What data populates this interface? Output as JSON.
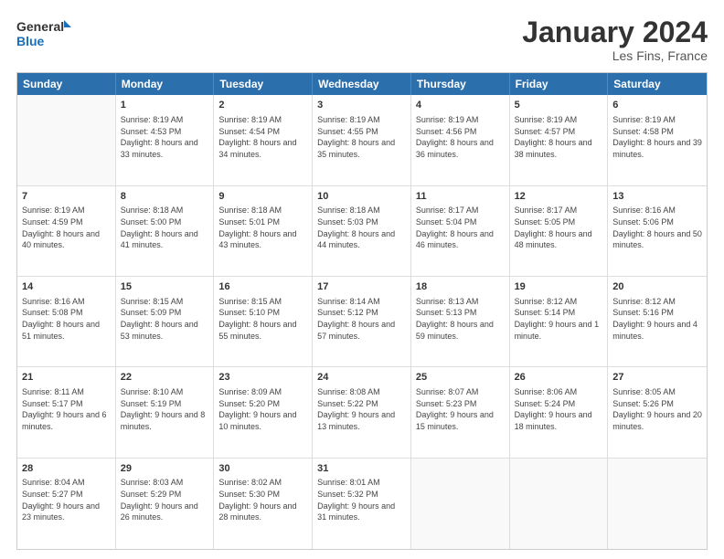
{
  "logo": {
    "line1": "General",
    "line2": "Blue"
  },
  "title": "January 2024",
  "subtitle": "Les Fins, France",
  "header_days": [
    "Sunday",
    "Monday",
    "Tuesday",
    "Wednesday",
    "Thursday",
    "Friday",
    "Saturday"
  ],
  "weeks": [
    [
      {
        "day": "",
        "sunrise": "",
        "sunset": "",
        "daylight": ""
      },
      {
        "day": "1",
        "sunrise": "Sunrise: 8:19 AM",
        "sunset": "Sunset: 4:53 PM",
        "daylight": "Daylight: 8 hours and 33 minutes."
      },
      {
        "day": "2",
        "sunrise": "Sunrise: 8:19 AM",
        "sunset": "Sunset: 4:54 PM",
        "daylight": "Daylight: 8 hours and 34 minutes."
      },
      {
        "day": "3",
        "sunrise": "Sunrise: 8:19 AM",
        "sunset": "Sunset: 4:55 PM",
        "daylight": "Daylight: 8 hours and 35 minutes."
      },
      {
        "day": "4",
        "sunrise": "Sunrise: 8:19 AM",
        "sunset": "Sunset: 4:56 PM",
        "daylight": "Daylight: 8 hours and 36 minutes."
      },
      {
        "day": "5",
        "sunrise": "Sunrise: 8:19 AM",
        "sunset": "Sunset: 4:57 PM",
        "daylight": "Daylight: 8 hours and 38 minutes."
      },
      {
        "day": "6",
        "sunrise": "Sunrise: 8:19 AM",
        "sunset": "Sunset: 4:58 PM",
        "daylight": "Daylight: 8 hours and 39 minutes."
      }
    ],
    [
      {
        "day": "7",
        "sunrise": "Sunrise: 8:19 AM",
        "sunset": "Sunset: 4:59 PM",
        "daylight": "Daylight: 8 hours and 40 minutes."
      },
      {
        "day": "8",
        "sunrise": "Sunrise: 8:18 AM",
        "sunset": "Sunset: 5:00 PM",
        "daylight": "Daylight: 8 hours and 41 minutes."
      },
      {
        "day": "9",
        "sunrise": "Sunrise: 8:18 AM",
        "sunset": "Sunset: 5:01 PM",
        "daylight": "Daylight: 8 hours and 43 minutes."
      },
      {
        "day": "10",
        "sunrise": "Sunrise: 8:18 AM",
        "sunset": "Sunset: 5:03 PM",
        "daylight": "Daylight: 8 hours and 44 minutes."
      },
      {
        "day": "11",
        "sunrise": "Sunrise: 8:17 AM",
        "sunset": "Sunset: 5:04 PM",
        "daylight": "Daylight: 8 hours and 46 minutes."
      },
      {
        "day": "12",
        "sunrise": "Sunrise: 8:17 AM",
        "sunset": "Sunset: 5:05 PM",
        "daylight": "Daylight: 8 hours and 48 minutes."
      },
      {
        "day": "13",
        "sunrise": "Sunrise: 8:16 AM",
        "sunset": "Sunset: 5:06 PM",
        "daylight": "Daylight: 8 hours and 50 minutes."
      }
    ],
    [
      {
        "day": "14",
        "sunrise": "Sunrise: 8:16 AM",
        "sunset": "Sunset: 5:08 PM",
        "daylight": "Daylight: 8 hours and 51 minutes."
      },
      {
        "day": "15",
        "sunrise": "Sunrise: 8:15 AM",
        "sunset": "Sunset: 5:09 PM",
        "daylight": "Daylight: 8 hours and 53 minutes."
      },
      {
        "day": "16",
        "sunrise": "Sunrise: 8:15 AM",
        "sunset": "Sunset: 5:10 PM",
        "daylight": "Daylight: 8 hours and 55 minutes."
      },
      {
        "day": "17",
        "sunrise": "Sunrise: 8:14 AM",
        "sunset": "Sunset: 5:12 PM",
        "daylight": "Daylight: 8 hours and 57 minutes."
      },
      {
        "day": "18",
        "sunrise": "Sunrise: 8:13 AM",
        "sunset": "Sunset: 5:13 PM",
        "daylight": "Daylight: 8 hours and 59 minutes."
      },
      {
        "day": "19",
        "sunrise": "Sunrise: 8:12 AM",
        "sunset": "Sunset: 5:14 PM",
        "daylight": "Daylight: 9 hours and 1 minute."
      },
      {
        "day": "20",
        "sunrise": "Sunrise: 8:12 AM",
        "sunset": "Sunset: 5:16 PM",
        "daylight": "Daylight: 9 hours and 4 minutes."
      }
    ],
    [
      {
        "day": "21",
        "sunrise": "Sunrise: 8:11 AM",
        "sunset": "Sunset: 5:17 PM",
        "daylight": "Daylight: 9 hours and 6 minutes."
      },
      {
        "day": "22",
        "sunrise": "Sunrise: 8:10 AM",
        "sunset": "Sunset: 5:19 PM",
        "daylight": "Daylight: 9 hours and 8 minutes."
      },
      {
        "day": "23",
        "sunrise": "Sunrise: 8:09 AM",
        "sunset": "Sunset: 5:20 PM",
        "daylight": "Daylight: 9 hours and 10 minutes."
      },
      {
        "day": "24",
        "sunrise": "Sunrise: 8:08 AM",
        "sunset": "Sunset: 5:22 PM",
        "daylight": "Daylight: 9 hours and 13 minutes."
      },
      {
        "day": "25",
        "sunrise": "Sunrise: 8:07 AM",
        "sunset": "Sunset: 5:23 PM",
        "daylight": "Daylight: 9 hours and 15 minutes."
      },
      {
        "day": "26",
        "sunrise": "Sunrise: 8:06 AM",
        "sunset": "Sunset: 5:24 PM",
        "daylight": "Daylight: 9 hours and 18 minutes."
      },
      {
        "day": "27",
        "sunrise": "Sunrise: 8:05 AM",
        "sunset": "Sunset: 5:26 PM",
        "daylight": "Daylight: 9 hours and 20 minutes."
      }
    ],
    [
      {
        "day": "28",
        "sunrise": "Sunrise: 8:04 AM",
        "sunset": "Sunset: 5:27 PM",
        "daylight": "Daylight: 9 hours and 23 minutes."
      },
      {
        "day": "29",
        "sunrise": "Sunrise: 8:03 AM",
        "sunset": "Sunset: 5:29 PM",
        "daylight": "Daylight: 9 hours and 26 minutes."
      },
      {
        "day": "30",
        "sunrise": "Sunrise: 8:02 AM",
        "sunset": "Sunset: 5:30 PM",
        "daylight": "Daylight: 9 hours and 28 minutes."
      },
      {
        "day": "31",
        "sunrise": "Sunrise: 8:01 AM",
        "sunset": "Sunset: 5:32 PM",
        "daylight": "Daylight: 9 hours and 31 minutes."
      },
      {
        "day": "",
        "sunrise": "",
        "sunset": "",
        "daylight": ""
      },
      {
        "day": "",
        "sunrise": "",
        "sunset": "",
        "daylight": ""
      },
      {
        "day": "",
        "sunrise": "",
        "sunset": "",
        "daylight": ""
      }
    ]
  ]
}
